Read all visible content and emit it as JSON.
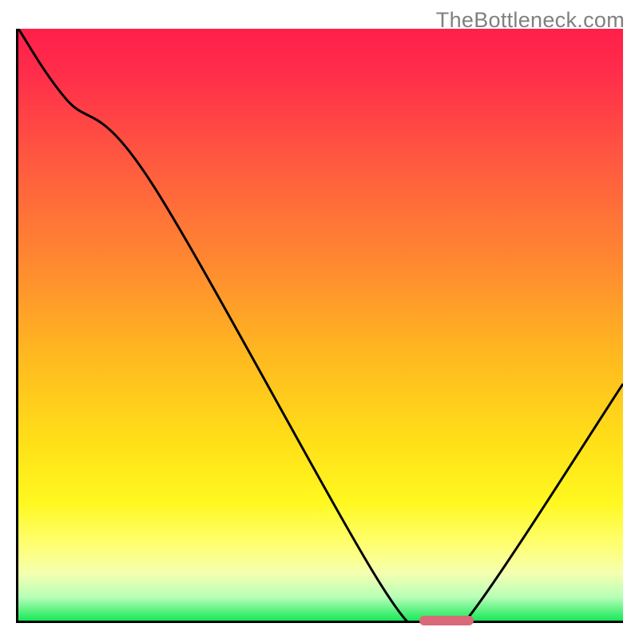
{
  "watermark": "TheBottleneck.com",
  "chart_data": {
    "type": "line",
    "title": "",
    "xlabel": "",
    "ylabel": "",
    "xlim": [
      0,
      100
    ],
    "ylim": [
      0,
      100
    ],
    "grid": false,
    "legend": false,
    "annotations": [],
    "background_gradient": {
      "stops": [
        {
          "pos": 0,
          "color": "#ff1f4a"
        },
        {
          "pos": 22,
          "color": "#ff5840"
        },
        {
          "pos": 40,
          "color": "#ff8a30"
        },
        {
          "pos": 55,
          "color": "#ffb820"
        },
        {
          "pos": 70,
          "color": "#ffe018"
        },
        {
          "pos": 80,
          "color": "#fff820"
        },
        {
          "pos": 92,
          "color": "#f5ffb0"
        },
        {
          "pos": 96,
          "color": "#b8ffb8"
        },
        {
          "pos": 100,
          "color": "#18e858"
        }
      ]
    },
    "series": [
      {
        "name": "bottleneck-curve",
        "type": "line",
        "color": "#000000",
        "x": [
          0,
          8,
          22,
          60,
          68,
          74,
          100
        ],
        "y": [
          100,
          88,
          74,
          6,
          0,
          0,
          40
        ]
      }
    ],
    "marker": {
      "name": "optimal-range",
      "color": "#d96a78",
      "x_start": 66,
      "x_end": 75,
      "y": 0
    }
  }
}
